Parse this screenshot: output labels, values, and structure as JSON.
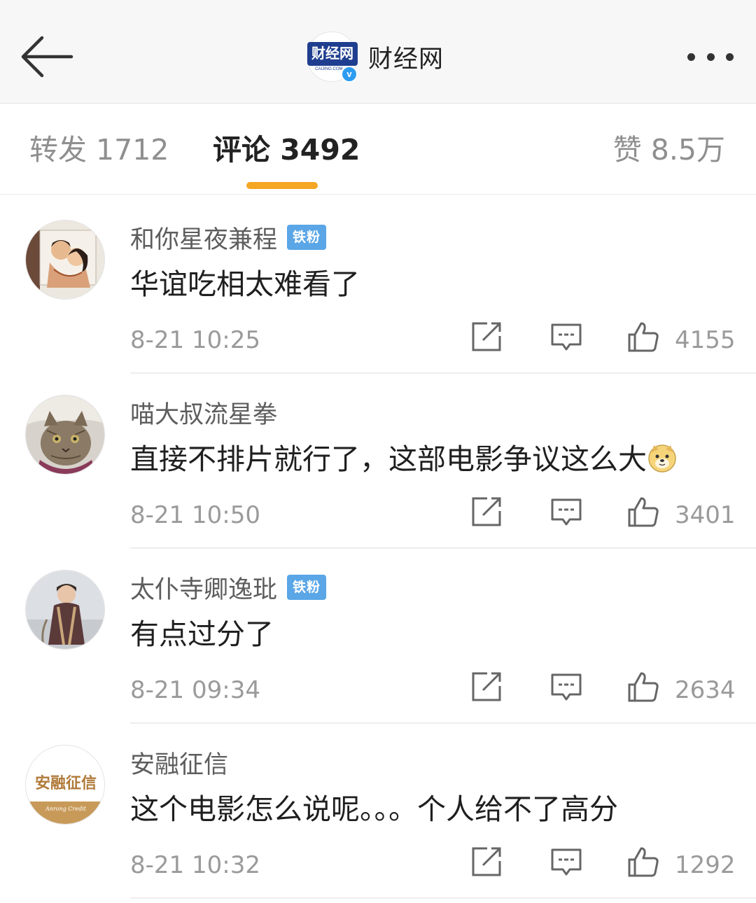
{
  "header": {
    "account_name": "财经网",
    "logo_text": "财经网",
    "logo_subtext": "CAIJING.COM.CN",
    "verified_mark": "v",
    "back_icon": "arrow-left-icon",
    "more_icon": "more-horizontal-icon"
  },
  "tabs": {
    "repost": "转发 1712",
    "comment": "评论 3492",
    "like": "赞 8.5万",
    "active": "comment",
    "underline_color": "#f5a623"
  },
  "comments": [
    {
      "username": "和你星夜兼程",
      "badge": "铁粉",
      "text": "华谊吃相太难看了",
      "time": "8-21 10:25",
      "likes": "4155"
    },
    {
      "username": "喵大叔流星拳",
      "badge": "",
      "text": "直接不排片就行了，这部电影争议这么大",
      "emoji": "doge-emoji",
      "time": "8-21 10:50",
      "likes": "3401"
    },
    {
      "username": "太仆寺卿逸玭",
      "badge": "铁粉",
      "text": "有点过分了",
      "time": "8-21 09:34",
      "likes": "2634"
    },
    {
      "username": "安融征信",
      "badge": "",
      "avatar_text": "安融征信",
      "avatar_subtext": "Anrong Credit",
      "text": "这个电影怎么说呢。。。个人给不了高分",
      "time": "8-21 10:32",
      "likes": "1292"
    }
  ],
  "colors": {
    "badge_blue": "#5aa6e6",
    "verified_blue": "#2d9cf0",
    "secondary_text": "#9a9a9a"
  }
}
